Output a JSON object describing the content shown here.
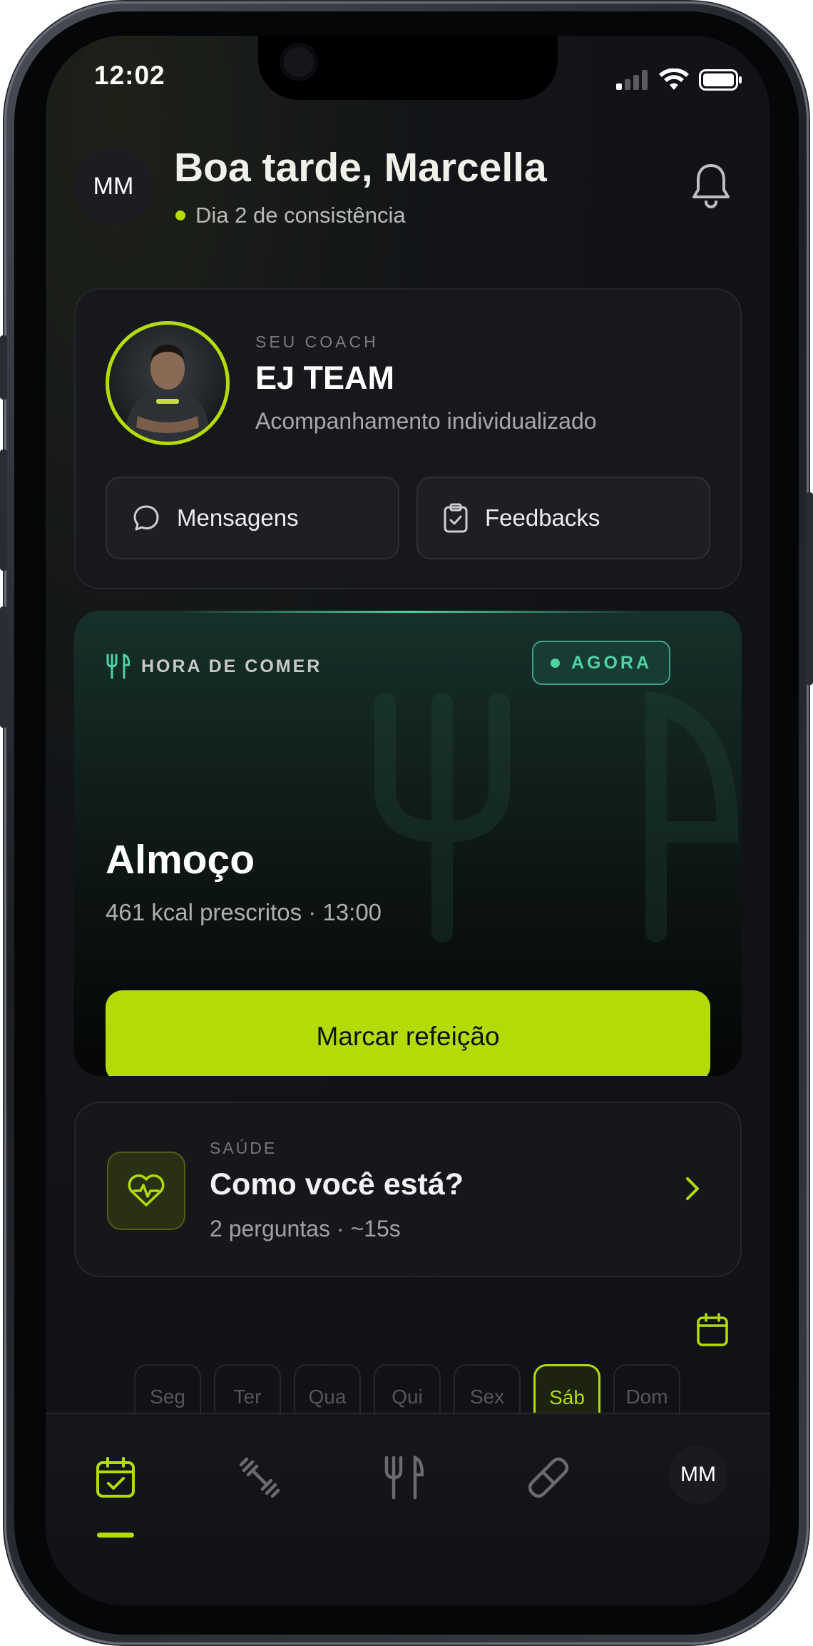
{
  "status": {
    "time": "12:02"
  },
  "header": {
    "avatar_initials": "MM",
    "greeting": "Boa tarde, Marcella",
    "streak_text": "Dia 2 de consistência"
  },
  "coach": {
    "label": "SEU COACH",
    "name": "EJ TEAM",
    "description": "Acompanhamento individualizado",
    "messages_label": "Mensagens",
    "feedbacks_label": "Feedbacks"
  },
  "meal": {
    "label": "HORA DE COMER",
    "badge": "AGORA",
    "title": "Almoço",
    "subtitle": "461 kcal prescritos · 13:00",
    "button_label": "Marcar refeição"
  },
  "health": {
    "label": "SAÚDE",
    "title": "Como você está?",
    "subtitle": "2 perguntas · ~15s"
  },
  "week": {
    "days": [
      "Seg",
      "Ter",
      "Qua",
      "Qui",
      "Sex",
      "Sáb",
      "Dom"
    ],
    "selected": "Sáb"
  },
  "tabbar": {
    "tabs": [
      "calendar-check-icon",
      "dumbbell-icon",
      "utensils-icon",
      "pill-icon"
    ],
    "profile_initials": "MM",
    "active_tab": "calendar-check-icon"
  },
  "colors": {
    "accent": "#b3dc06",
    "mint": "#4fd3a3",
    "background": "#121418"
  }
}
